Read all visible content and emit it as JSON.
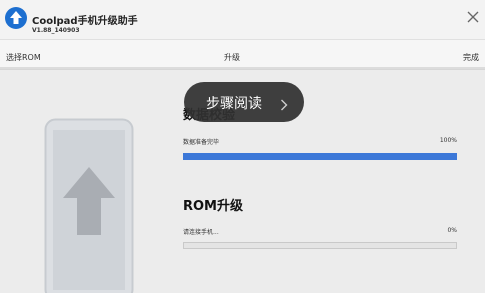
{
  "titlebar": {
    "app_name": "Coolpad手机升级助手",
    "version": "V1.88_140903",
    "icons": {
      "logo": "upload-arrow-logo-icon",
      "close": "close-icon"
    }
  },
  "steps": {
    "items": [
      {
        "label": "选择ROM"
      },
      {
        "label": "升级"
      },
      {
        "label": "完成"
      }
    ],
    "progress": 0
  },
  "verify": {
    "title": "数据校验",
    "status": "数据准备完毕",
    "percent_label": "100%",
    "progress": 1.0
  },
  "rom": {
    "title": "ROM升级",
    "status": "请连接手机...",
    "percent_label": "0%",
    "progress": 0.0
  },
  "overlay": {
    "label": "步骤阅读",
    "icon": "chevron-right-icon"
  },
  "illustration": {
    "icon": "phone-upload-icon"
  },
  "colors": {
    "accent": "#3c78d8",
    "logo": "#1d6fd0",
    "background": "#ececec"
  }
}
